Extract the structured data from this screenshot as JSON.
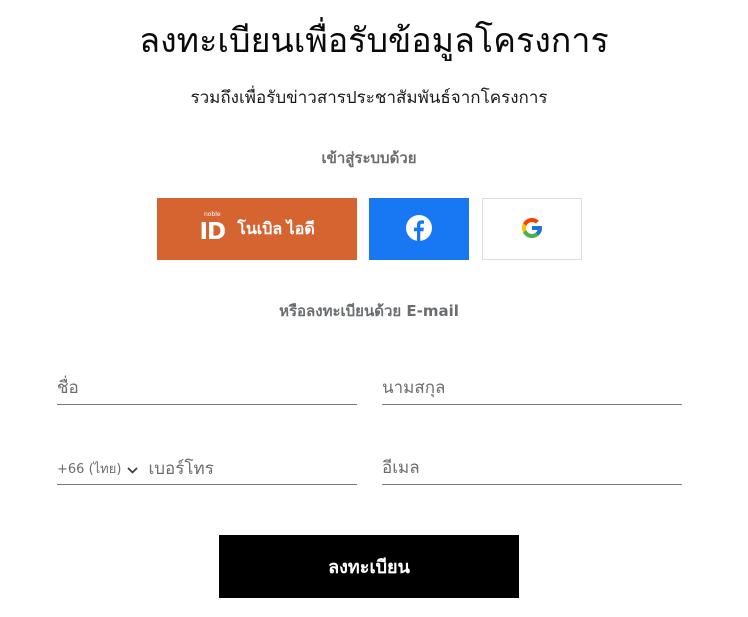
{
  "header": {
    "title": "ลงทะเบียนเพื่อรับข้อมูลโครงการ",
    "subtitle": "รวมถึงเพื่อรับข่าวสารประชาสัมพันธ์จากโครงการ"
  },
  "social": {
    "heading": "เข้าสู่ระบบด้วย",
    "noble": {
      "logo_small": "noble",
      "logo_big": "ID",
      "label": "โนเบิล ไอดี",
      "color": "#d66431"
    },
    "facebook": {
      "icon": "facebook-icon",
      "color": "#1877f2"
    },
    "google": {
      "icon": "google-icon"
    }
  },
  "email_section": {
    "heading": "หรือลงทะเบียนด้วย E-mail"
  },
  "form": {
    "first_name": {
      "placeholder": "ชื่อ",
      "value": ""
    },
    "last_name": {
      "placeholder": "นามสกุล",
      "value": ""
    },
    "phone": {
      "country_code": "+66 (ไทย)",
      "placeholder": "เบอร์โทร",
      "value": ""
    },
    "email": {
      "placeholder": "อีเมล",
      "value": ""
    }
  },
  "submit": {
    "label": "ลงทะเบียน"
  }
}
